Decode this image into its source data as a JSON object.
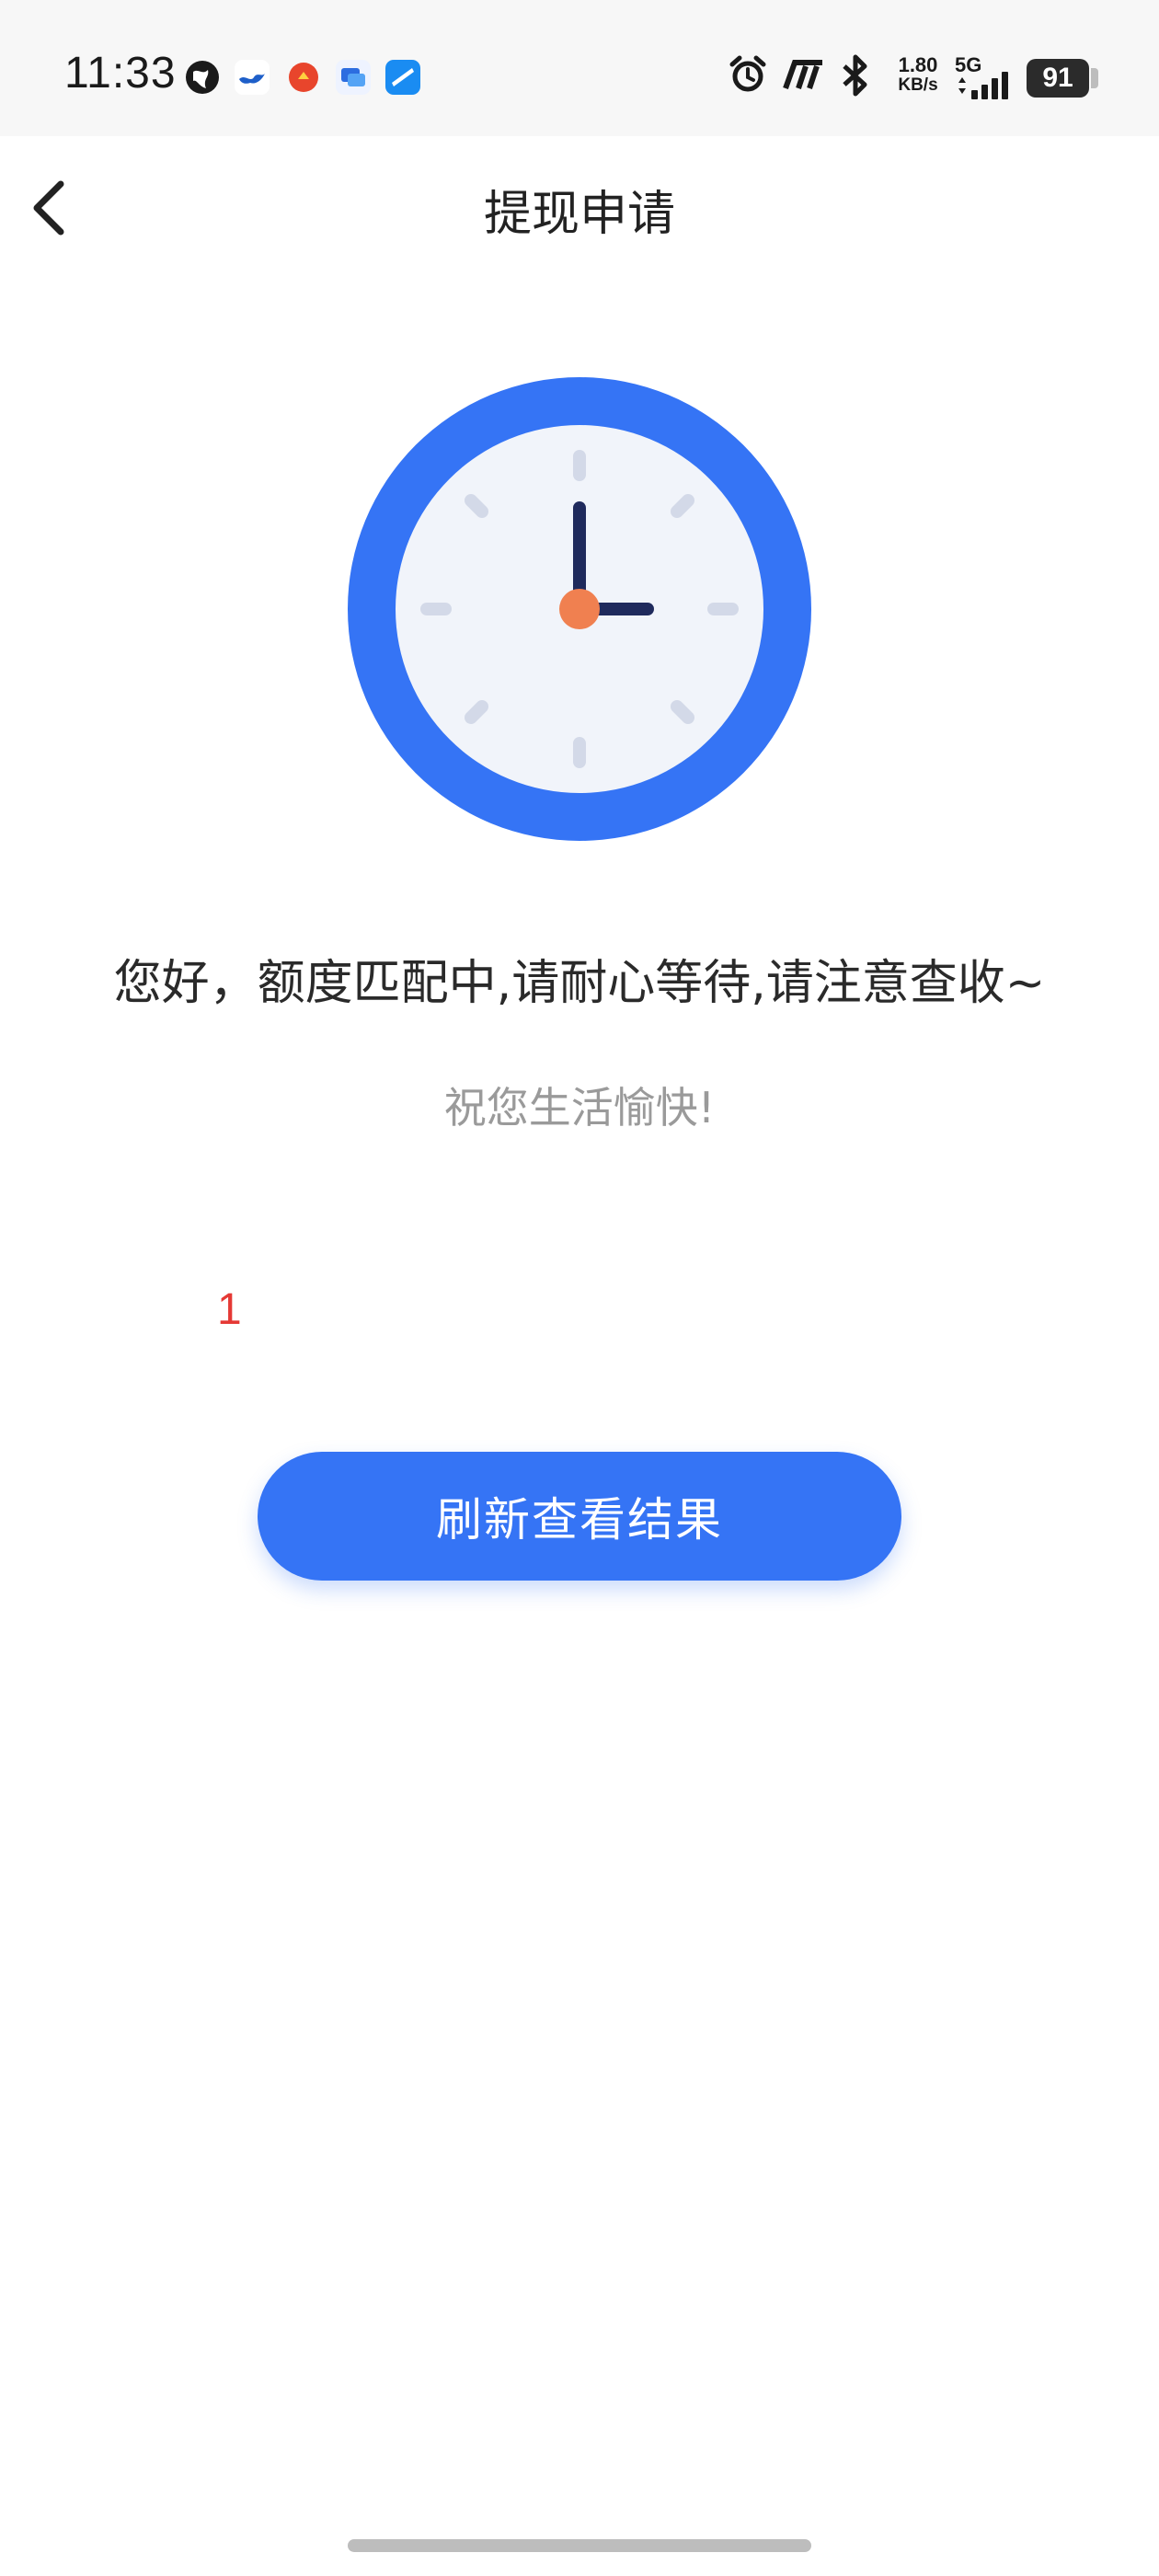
{
  "status_bar": {
    "time": "11:33",
    "net_speed_value": "1.80",
    "net_speed_unit": "KB/s",
    "network_type": "5G",
    "battery": "91",
    "icons": [
      "globe-icon",
      "bird-app-icon",
      "red-app-icon",
      "chat-app-icon",
      "browser-app-icon",
      "alarm-icon",
      "hd-icon",
      "bluetooth-icon",
      "signal-icon"
    ]
  },
  "header": {
    "title": "提现申请",
    "back_icon": "chevron-left-icon"
  },
  "illustration": {
    "icon": "clock-icon",
    "colors": {
      "ring": "#3574F5",
      "face": "#F1F4FA",
      "hands": "#1F2A5C",
      "center": "#F08050",
      "ticks": "#D3D9E8"
    }
  },
  "content": {
    "message": "您好，额度匹配中,请耐心等待,请注意查收~",
    "wish": "祝您生活愉快!",
    "counter": "1"
  },
  "actions": {
    "refresh_label": "刷新查看结果"
  },
  "colors": {
    "accent": "#3574F5",
    "counter": "#E53935",
    "secondary_text": "#9A9A9A"
  }
}
